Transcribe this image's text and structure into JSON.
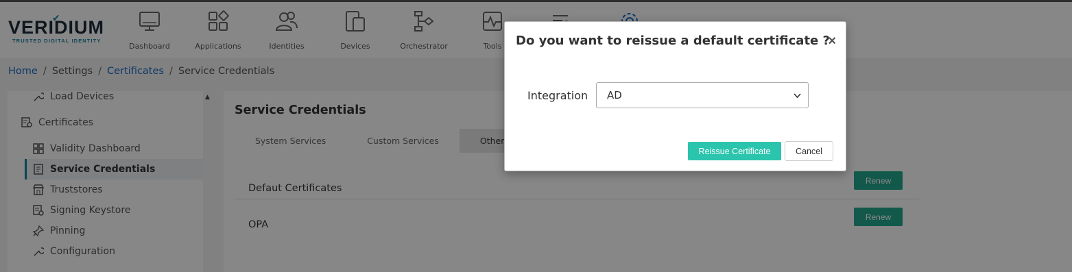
{
  "brand": {
    "name": "VERIDIUM",
    "tagline": "TRUSTED DIGITAL IDENTITY",
    "color": "#1a7fa0"
  },
  "nav": {
    "items": [
      {
        "label": "Dashboard",
        "icon": "monitor-icon"
      },
      {
        "label": "Applications",
        "icon": "apps-grid-icon"
      },
      {
        "label": "Identities",
        "icon": "users-icon"
      },
      {
        "label": "Devices",
        "icon": "devices-icon"
      },
      {
        "label": "Orchestrator",
        "icon": "flow-icon"
      },
      {
        "label": "Tools",
        "icon": "pulse-icon"
      },
      {
        "label": "",
        "icon": "list-search-icon"
      },
      {
        "label": "",
        "icon": "gear-icon"
      }
    ]
  },
  "breadcrumb": {
    "home": "Home",
    "settings": "Settings",
    "certificates": "Certificates",
    "current": "Service Credentials"
  },
  "sidebar": {
    "items": [
      {
        "label": "Load Devices",
        "icon": "wrench-icon"
      },
      {
        "label": "Certificates",
        "icon": "certificate-icon"
      },
      {
        "label": "Validity Dashboard",
        "icon": "dashboard-grid-icon"
      },
      {
        "label": "Service Credentials",
        "icon": "document-icon",
        "active": true
      },
      {
        "label": "Truststores",
        "icon": "store-icon"
      },
      {
        "label": "Signing Keystore",
        "icon": "signing-icon"
      },
      {
        "label": "Pinning",
        "icon": "pin-icon"
      },
      {
        "label": "Configuration",
        "icon": "wrench-icon"
      }
    ]
  },
  "main": {
    "title": "Service Credentials",
    "tabs": [
      "System Services",
      "Custom Services",
      "Others"
    ],
    "active_tab": "Others",
    "rows": [
      {
        "label": "Defaut Certificates",
        "action": "Renew"
      },
      {
        "label": "OPA",
        "action": "Renew"
      }
    ]
  },
  "modal": {
    "title": "Do you want to reissue a default certificate ?",
    "close": "×",
    "field_label": "Integration",
    "select_value": "AD",
    "primary_button": "Reissue Certificate",
    "secondary_button": "Cancel"
  },
  "colors": {
    "accent": "#2bc4ad",
    "renew": "#23a88f",
    "link": "#1769c6"
  }
}
